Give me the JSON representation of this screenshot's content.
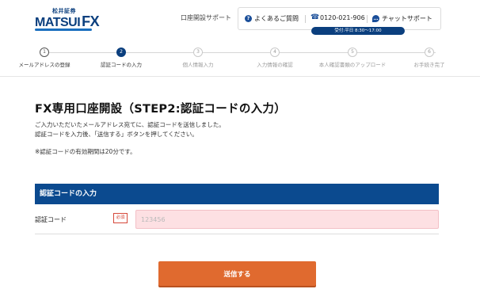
{
  "brand": {
    "company": "松井証券",
    "product": "MATSUI",
    "product_suffix": "FX"
  },
  "header": {
    "support_label": "口座開設サポート",
    "faq_label": "よくあるご質問",
    "phone_label": "0120-021-906",
    "chat_label": "チャットサポート",
    "hours_label": "受付:平日 8:30〜17:00"
  },
  "steps": [
    {
      "number": "1",
      "label": "メールアドレスの登録",
      "state": "done"
    },
    {
      "number": "2",
      "label": "認証コードの入力",
      "state": "active"
    },
    {
      "number": "3",
      "label": "個人情報入力",
      "state": "pending"
    },
    {
      "number": "4",
      "label": "入力情報の確認",
      "state": "pending"
    },
    {
      "number": "5",
      "label": "本人確認書類のアップロード",
      "state": "pending"
    },
    {
      "number": "6",
      "label": "お手続き完了",
      "state": "pending"
    }
  ],
  "main": {
    "title": "FX専用口座開設（STEP2:認証コードの入力）",
    "description_line1": "ご入力いただいたメールアドレス宛てに、認証コードを送信しました。",
    "description_line2": "認証コードを入力後、「送信する」ボタンを押してください。",
    "note": "※認証コードの有効期間は20分です。"
  },
  "form": {
    "section_title": "認証コードの入力",
    "field_label": "認証コード",
    "required_badge": "必須",
    "code_value": "",
    "code_placeholder": "123456",
    "submit_label": "送信する"
  },
  "colors": {
    "brand_navy": "#0b3f7e",
    "section_header": "#0b4a8f",
    "submit_orange": "#e06a2f",
    "input_error_bg": "#fde0e3",
    "required_red": "#d6483a"
  }
}
